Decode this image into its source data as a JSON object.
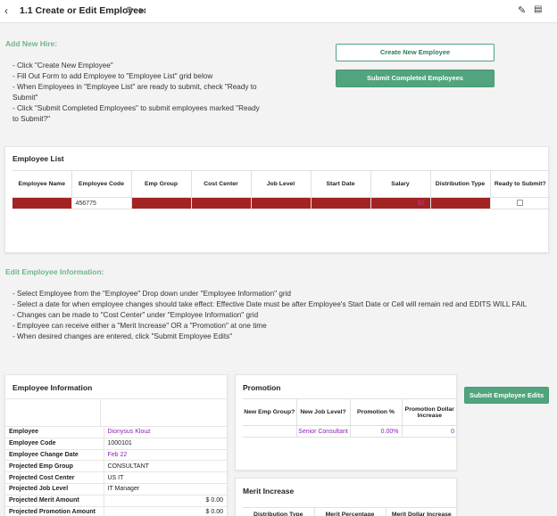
{
  "header": {
    "title": "1.1 Create or Edit Employee",
    "back_icon": "‹",
    "refresh_icon": "⟳",
    "share_icon": "⋈",
    "edit_icon": "✎",
    "comment_icon": "▤"
  },
  "add_hire": {
    "heading": "Add New Hire:",
    "lines": [
      "- Click \"Create New Employee\"",
      "- Fill Out Form to add Employee to \"Employee List\" grid below",
      "- When Employees in \"Employee List\" are ready to submit, check \"Ready to",
      "Submit\"",
      "- Click \"Submit Completed Employees\" to submit employees marked \"Ready",
      "to Submit?\""
    ],
    "create_button": "Create New Employee",
    "submit_button": "Submit Completed Employees"
  },
  "employee_list": {
    "title": "Employee List",
    "columns": [
      "Employee Name",
      "Employee Code",
      "Emp Group",
      "Cost Center",
      "Job Level",
      "Start Date",
      "Salary",
      "Distribution Type",
      "Ready to Submit?"
    ],
    "row": {
      "employee_code": "456775",
      "salary": "$0"
    }
  },
  "edit_info": {
    "heading": "Edit Employee Information:",
    "lines": [
      "- Select Employee from the \"Employee\" Drop down under \"Employee Information\" grid",
      "- Select a date for when employee changes should take effect: Effective Date must be after Employee's Start Date or Cell will remain red and EDITS WILL FAIL",
      "- Changes can be made to \"Cost Center\" under \"Employee Information\" grid",
      "- Employee can receive either a \"Merit Increase\" OR a \"Promotion\" at one time",
      "- When desired changes are entered, click \"Submit Employee Edits\""
    ]
  },
  "employee_information": {
    "title": "Employee Information",
    "rows": [
      {
        "label": "Employee",
        "value": "Dionysus Klouz"
      },
      {
        "label": "Employee Code",
        "value": "1000101"
      },
      {
        "label": "Employee Change Date",
        "value": "Feb 22"
      },
      {
        "label": "Projected Emp Group",
        "value": "CONSULTANT"
      },
      {
        "label": "Projected Cost Center",
        "value": "US IT"
      },
      {
        "label": "Projected Job Level",
        "value": "IT Manager"
      },
      {
        "label": "Projected Merit Amount",
        "value": "$ 0.00"
      },
      {
        "label": "Projected Promotion Amount",
        "value": "$ 0.00"
      }
    ]
  },
  "promotion": {
    "title": "Promotion",
    "columns": [
      "New Emp Group?",
      "New Job Level?",
      "Promotion %",
      "Promotion Dollar Increase"
    ],
    "row": [
      "",
      "Senior Consultant",
      "0.00%",
      "0"
    ]
  },
  "submit_edits_button": "Submit Employee Edits",
  "merit": {
    "title": "Merit Increase",
    "columns": [
      "Distribution Type",
      "Merit Percentage",
      "Merit Dollar Increase"
    ]
  },
  "colors": {
    "accent_green": "#51a47d",
    "heading_green": "#6fb788",
    "invalid_red": "#a32323",
    "value_purple": "#8c22b9"
  }
}
